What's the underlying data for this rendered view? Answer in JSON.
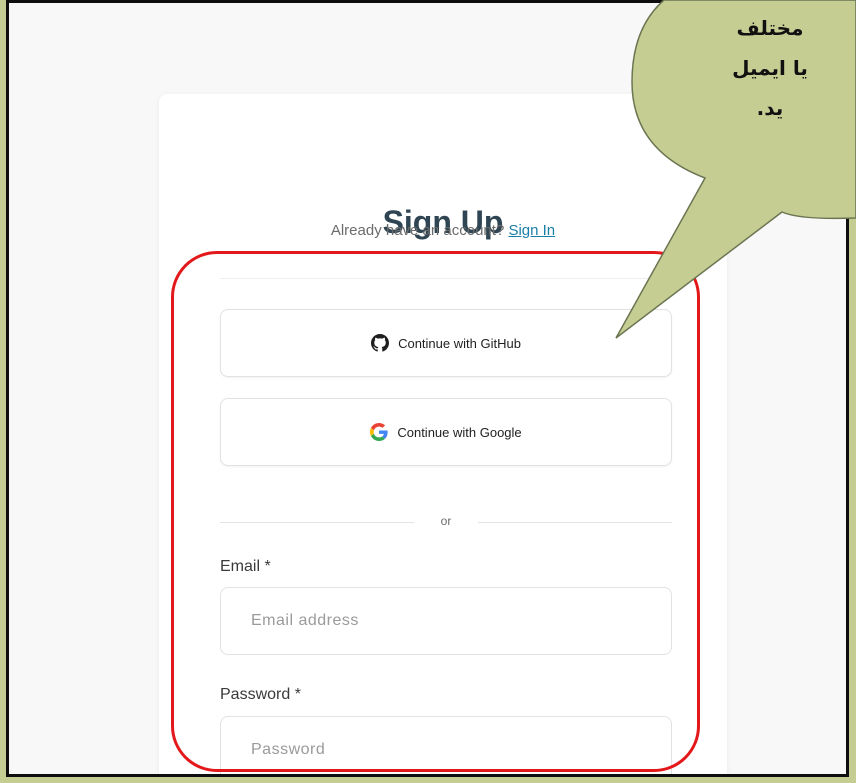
{
  "signup": {
    "title": "Sign Up",
    "subtitle_prefix": "Already have an account? ",
    "signin_link": "Sign In",
    "github_button": "Continue with GitHub",
    "google_button": "Continue with Google",
    "or_label": "or",
    "email_label": "Email *",
    "email_placeholder": "Email address",
    "password_label": "Password *",
    "password_placeholder": "Password"
  },
  "annotation": {
    "callout_text": "مختلف\nیا ایمیل\nید.",
    "highlight_color": "#e3181b",
    "callout_fill": "#c5cd92"
  },
  "icons": {
    "github": "github-icon",
    "google": "google-icon"
  }
}
